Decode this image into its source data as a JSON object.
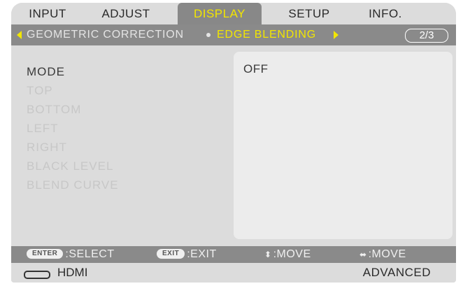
{
  "tabs": [
    {
      "label": "INPUT",
      "active": false
    },
    {
      "label": "ADJUST",
      "active": false
    },
    {
      "label": "DISPLAY",
      "active": true
    },
    {
      "label": "SETUP",
      "active": false
    },
    {
      "label": "INFO.",
      "active": false
    }
  ],
  "subheader": {
    "item1": "GEOMETRIC CORRECTION",
    "item2": "EDGE BLENDING",
    "page": "2/3"
  },
  "menu_items": [
    {
      "label": "MODE",
      "enabled": true
    },
    {
      "label": "TOP",
      "enabled": false
    },
    {
      "label": "BOTTOM",
      "enabled": false
    },
    {
      "label": "LEFT",
      "enabled": false
    },
    {
      "label": "RIGHT",
      "enabled": false
    },
    {
      "label": "BLACK LEVEL",
      "enabled": false
    },
    {
      "label": "BLEND CURVE",
      "enabled": false
    }
  ],
  "mode_value": "OFF",
  "help": {
    "enter_key": "ENTER",
    "select_label": ":SELECT",
    "exit_key": "EXIT",
    "exit_label": ":EXIT",
    "move_v_label": ":MOVE",
    "move_h_label": ":MOVE"
  },
  "status": {
    "input": "HDMI",
    "mode": "ADVANCED"
  },
  "colors": {
    "highlight": "#f2e600",
    "bar": "#8a8a8a",
    "panel": "#dcdcdc"
  }
}
